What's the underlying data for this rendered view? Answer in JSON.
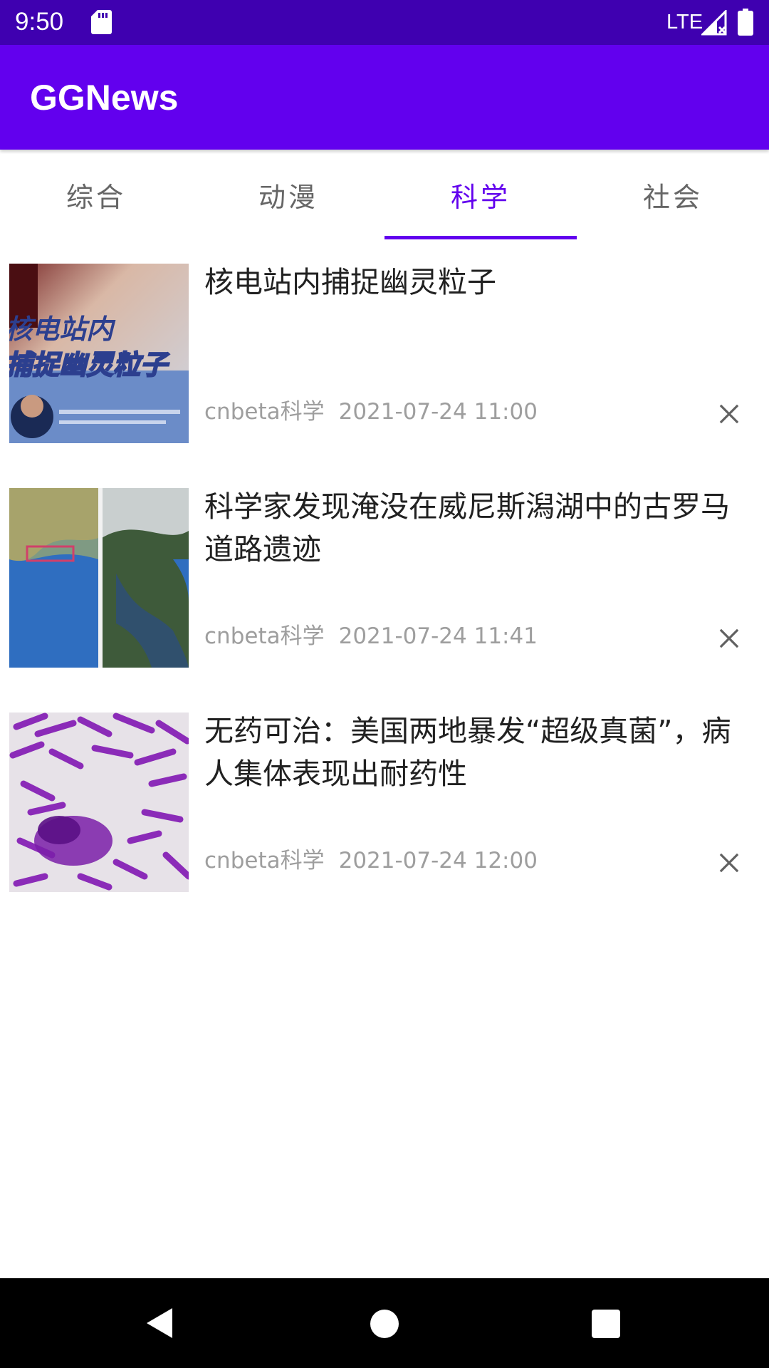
{
  "status_bar": {
    "time": "9:50",
    "network": "LTE",
    "sd_icon": "sd-card-icon",
    "signal_icon": "signal-icon",
    "battery_icon": "battery-icon",
    "bar_color": "#3F00B0"
  },
  "app_bar": {
    "title": "GGNews",
    "color": "#6200EE"
  },
  "tabs": [
    {
      "label": "综合",
      "active": false
    },
    {
      "label": "动漫",
      "active": false
    },
    {
      "label": "科学",
      "active": true
    },
    {
      "label": "社会",
      "active": false
    }
  ],
  "news": [
    {
      "title": "核电站内捕捉幽灵粒子",
      "source": "cnbeta科学",
      "time": "2021-07-24 11:00",
      "thumb_text": "核电站内捕捉幽灵粒子"
    },
    {
      "title": "科学家发现淹没在威尼斯潟湖中的古罗马道路遗迹",
      "source": "cnbeta科学",
      "time": "2021-07-24 11:41"
    },
    {
      "title": "无药可治：美国两地暴发“超级真菌”，病人集体表现出耐药性",
      "source": "cnbeta科学",
      "time": "2021-07-24 12:00"
    }
  ],
  "nav_bar": {
    "back_icon": "back-triangle-icon",
    "home_icon": "home-circle-icon",
    "recent_icon": "recent-square-icon"
  }
}
